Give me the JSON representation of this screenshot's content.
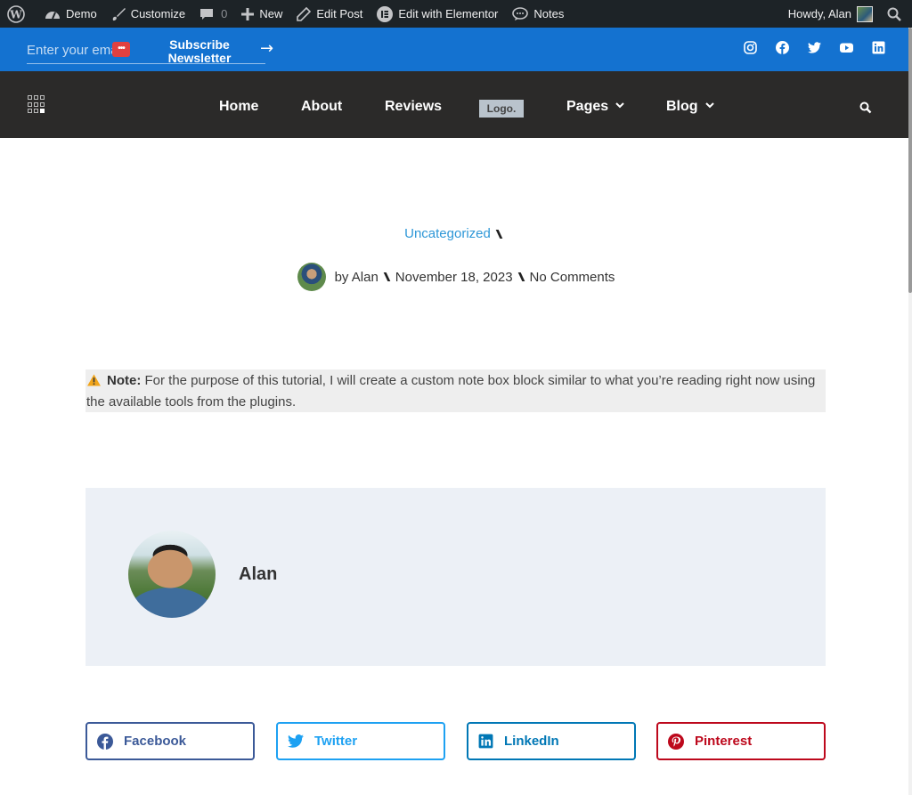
{
  "admin_bar": {
    "items": [
      {
        "label": ""
      },
      {
        "label": "Demo"
      },
      {
        "label": "Customize"
      },
      {
        "label": "0"
      },
      {
        "label": "New"
      },
      {
        "label": "Edit Post"
      },
      {
        "label": "Edit with Elementor"
      },
      {
        "label": "Notes"
      }
    ],
    "howdy": "Howdy, Alan"
  },
  "top_bar": {
    "email_placeholder": "Enter your email",
    "subscribe_line1": "Subscribe",
    "subscribe_line2": "Newsletter",
    "arrow": "→",
    "password_badge": "•••",
    "socials": [
      "instagram-icon",
      "facebook-icon",
      "twitter-icon",
      "youtube-icon",
      "linkedin-icon"
    ],
    "bg_color": "#1472d0"
  },
  "nav": {
    "items": [
      "Home",
      "About",
      "Reviews",
      "Pages",
      "Blog"
    ],
    "logo": "Logo.",
    "bg_color": "#2b2a29"
  },
  "post": {
    "category": "Uncategorized",
    "author": "by Alan",
    "date": "November 18, 2023",
    "comments": "No Comments"
  },
  "note": {
    "label": "Note:",
    "text": "For the purpose of this tutorial, I will create a custom note box block similar to what you’re reading right now using the available tools from the plugins."
  },
  "author_box": {
    "name": "Alan"
  },
  "share": {
    "facebook": "Facebook",
    "twitter": "Twitter",
    "linkedin": "LinkedIn",
    "pinterest": "Pinterest",
    "colors": {
      "facebook": "#3b5998",
      "twitter": "#1da1f2",
      "linkedin": "#0077b5",
      "pinterest": "#bd081c"
    }
  }
}
